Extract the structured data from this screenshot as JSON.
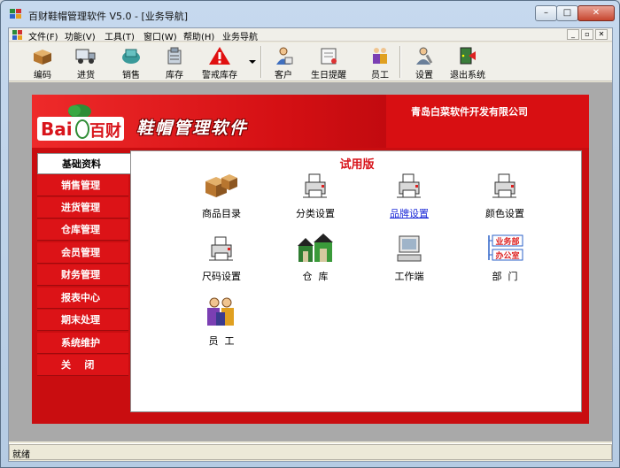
{
  "window": {
    "title": "百财鞋帽管理软件 V5.0 - [业务导航]"
  },
  "window_controls": {
    "minimize": "–",
    "maximize": "□",
    "close": "✕"
  },
  "mdi_controls": {
    "minimize": "_",
    "restore": "▫",
    "close": "✕"
  },
  "menu": [
    {
      "label": "文件(F)"
    },
    {
      "label": "功能(V)"
    },
    {
      "label": "工具(T)"
    },
    {
      "label": "窗口(W)"
    },
    {
      "label": "帮助(H)"
    },
    {
      "label": "业务导航"
    }
  ],
  "toolbar": [
    {
      "label": "编码",
      "icon": "boxes-icon"
    },
    {
      "label": "进货",
      "icon": "truck-icon"
    },
    {
      "label": "销售",
      "icon": "sales-icon"
    },
    {
      "label": "库存",
      "icon": "warehouse-icon"
    },
    {
      "label": "警戒库存",
      "icon": "warning-icon"
    },
    {
      "label": "客户",
      "icon": "customer-icon"
    },
    {
      "label": "生日提醒",
      "icon": "birthday-icon"
    },
    {
      "label": "员工",
      "icon": "staff-icon"
    },
    {
      "label": "设置",
      "icon": "settings-icon"
    },
    {
      "label": "退出系统",
      "icon": "exit-icon"
    }
  ],
  "banner": {
    "logo_text": "Bai",
    "logo_cn": "百财",
    "product": "鞋帽管理软件",
    "company": "青岛白菜软件开发有限公司",
    "colors": {
      "red": "#d80f12",
      "white": "#ffffff"
    }
  },
  "panel": {
    "title": "试用版"
  },
  "nav": [
    {
      "label": "基础资料",
      "active": true
    },
    {
      "label": "销售管理"
    },
    {
      "label": "进货管理"
    },
    {
      "label": "仓库管理"
    },
    {
      "label": "会员管理"
    },
    {
      "label": "财务管理"
    },
    {
      "label": "报表中心"
    },
    {
      "label": "期末处理"
    },
    {
      "label": "系统维护"
    },
    {
      "label": "关    闭"
    }
  ],
  "functions": [
    {
      "label": "商品目录",
      "icon": "boxes-icon"
    },
    {
      "label": "分类设置",
      "icon": "printer-icon"
    },
    {
      "label": "品牌设置",
      "icon": "printer-icon",
      "hovered": true
    },
    {
      "label": "颜色设置",
      "icon": "printer-icon"
    },
    {
      "label": "尺码设置",
      "icon": "printer-icon"
    },
    {
      "label": "仓  库",
      "icon": "warehouse-building-icon"
    },
    {
      "label": "工作端",
      "icon": "computer-icon"
    },
    {
      "label": "部  门",
      "icon": "department-icon",
      "tag1": "业务部",
      "tag2": "办公室"
    },
    {
      "label": "员  工",
      "icon": "staff-icon"
    }
  ],
  "status": {
    "text": "就绪"
  }
}
